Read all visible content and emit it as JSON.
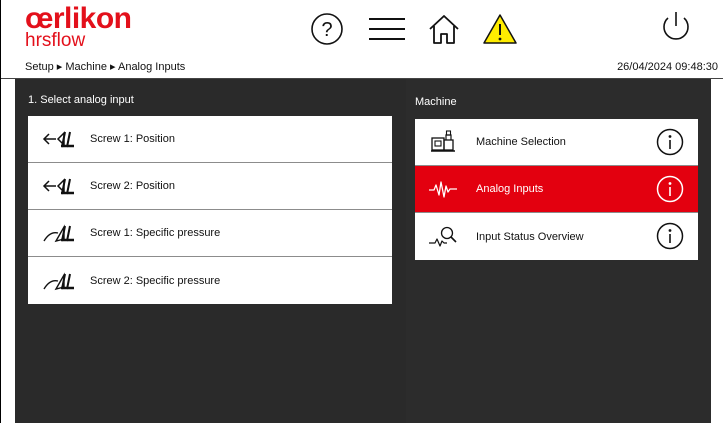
{
  "header": {
    "brand": "œrlikon",
    "sub_brand": "hrsflow",
    "breadcrumb": "Setup ▸ Machine ▸ Analog Inputs",
    "datetime": "26/04/2024 09:48:30",
    "icons": [
      "help-icon",
      "menu-icon",
      "home-icon",
      "warning-icon",
      "power-icon"
    ],
    "warning_color": "#ffec00"
  },
  "left_panel": {
    "title": "1. Select analog input",
    "items": [
      {
        "label": "Screw 1: Position",
        "icon": "screw-position-icon"
      },
      {
        "label": "Screw 2: Position",
        "icon": "screw-position-icon"
      },
      {
        "label": "Screw 1: Specific pressure",
        "icon": "screw-pressure-icon"
      },
      {
        "label": "Screw 2: Specific pressure",
        "icon": "screw-pressure-icon"
      }
    ]
  },
  "right_panel": {
    "title": "Machine",
    "items": [
      {
        "label": "Machine Selection",
        "icon": "machine-icon",
        "active": false
      },
      {
        "label": "Analog Inputs",
        "icon": "waveform-icon",
        "active": true
      },
      {
        "label": "Input Status Overview",
        "icon": "status-search-icon",
        "active": false
      }
    ]
  },
  "colors": {
    "brand": "#e3101b",
    "active": "#e3000f",
    "panel": "#2a2a2a"
  }
}
